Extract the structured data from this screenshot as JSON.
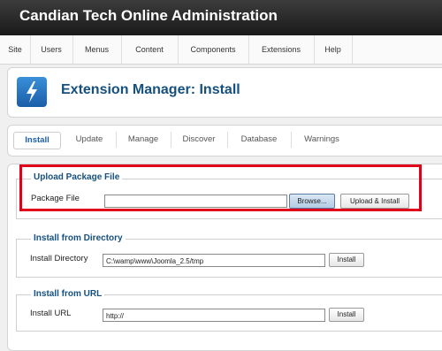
{
  "header": {
    "title": "Candian Tech Online Administration"
  },
  "menu": [
    "Site",
    "Users",
    "Menus",
    "Content",
    "Components",
    "Extensions",
    "Help"
  ],
  "toolbar": {
    "title": "Extension Manager: Install",
    "icon": "install-icon"
  },
  "subnav": {
    "tabs": [
      "Install",
      "Update",
      "Manage",
      "Discover",
      "Database",
      "Warnings"
    ],
    "active": "Install"
  },
  "upload": {
    "legend": "Upload Package File",
    "label": "Package File",
    "value": "",
    "browse": "Browse...",
    "button": "Upload & Install"
  },
  "directory": {
    "legend": "Install from Directory",
    "label": "Install Directory",
    "value": "C:\\wamp\\www\\Joomla_2.5/tmp",
    "button": "Install"
  },
  "url": {
    "legend": "Install from URL",
    "label": "Install URL",
    "value": "http://",
    "button": "Install"
  },
  "colors": {
    "accent": "#15507e",
    "highlight": "#e0001a"
  }
}
